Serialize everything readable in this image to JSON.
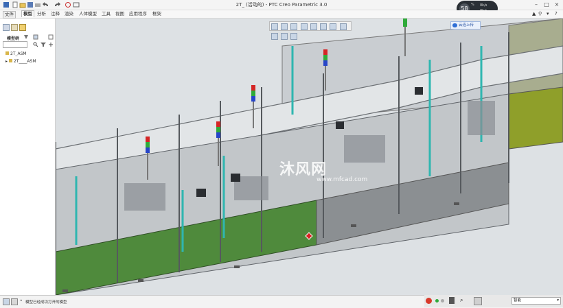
{
  "window": {
    "title": "2T_ (活动的) - PTC Creo Parametric 3.0"
  },
  "menus": [
    "文件",
    "模型",
    "分析",
    "注释",
    "渲染",
    "人体模型",
    "工具",
    "视图",
    "应用程序",
    "框架"
  ],
  "active_menu": "模型",
  "timer": {
    "value": "58",
    "unit": "%",
    "line1": "0k/s",
    "line2": "0k/s"
  },
  "cloud_button": "云连上传",
  "panel": {
    "tab_label": "模型树",
    "tree": {
      "root": "2T_ASM",
      "child": "2T____ASM"
    }
  },
  "watermark": {
    "main": "沐风网",
    "sub": "www.mfcad.com"
  },
  "status": {
    "message": "模型已经成功打开的模型"
  },
  "filter": {
    "value": "智能"
  }
}
